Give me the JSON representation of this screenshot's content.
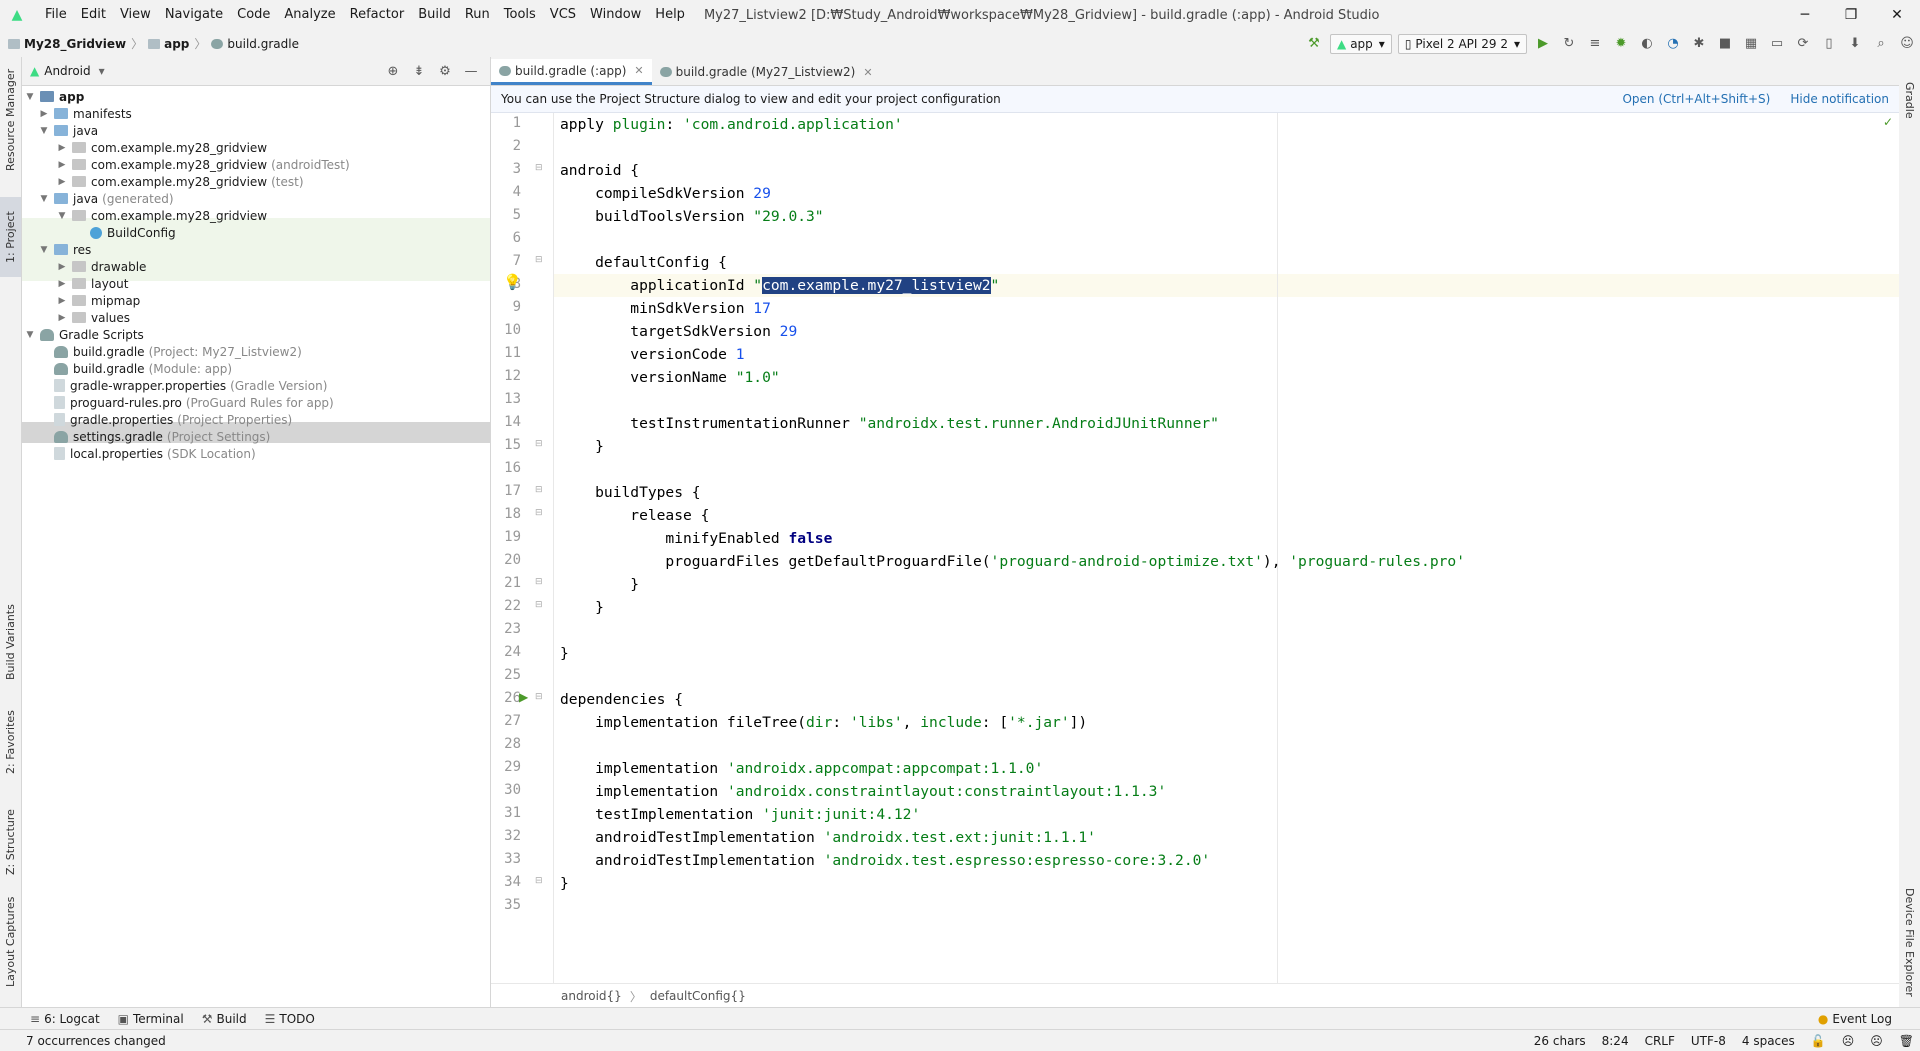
{
  "app": {
    "window_title": "My27_Listview2 [D:₩Study_Android₩workspace₩My28_Gridview] - build.gradle (:app) - Android Studio",
    "menu": [
      "File",
      "Edit",
      "View",
      "Navigate",
      "Code",
      "Analyze",
      "Refactor",
      "Build",
      "Run",
      "Tools",
      "VCS",
      "Window",
      "Help"
    ]
  },
  "navbar": {
    "crumbs": [
      "My28_Gridview",
      "app",
      "build.gradle"
    ],
    "run_config": "app",
    "device": "Pixel 2 API 29 2"
  },
  "left_stripe": [
    "Resource Manager",
    "1: Project",
    "Build Variants",
    "2: Favorites",
    "Z: Structure",
    "Layout Captures"
  ],
  "right_stripe": [
    "Gradle",
    "Device File Explorer"
  ],
  "project": {
    "view_mode": "Android",
    "tree": [
      {
        "label": "app",
        "hint": ""
      },
      {
        "label": "manifests",
        "hint": ""
      },
      {
        "label": "java",
        "hint": ""
      },
      {
        "label": "com.example.my28_gridview",
        "hint": ""
      },
      {
        "label": "com.example.my28_gridview",
        "hint": "(androidTest)"
      },
      {
        "label": "com.example.my28_gridview",
        "hint": "(test)"
      },
      {
        "label": "java",
        "hint": "(generated)"
      },
      {
        "label": "com.example.my28_gridview",
        "hint": ""
      },
      {
        "label": "BuildConfig",
        "hint": ""
      },
      {
        "label": "res",
        "hint": ""
      },
      {
        "label": "drawable",
        "hint": ""
      },
      {
        "label": "layout",
        "hint": ""
      },
      {
        "label": "mipmap",
        "hint": ""
      },
      {
        "label": "values",
        "hint": ""
      },
      {
        "label": "Gradle Scripts",
        "hint": ""
      },
      {
        "label": "build.gradle",
        "hint": "(Project: My27_Listview2)"
      },
      {
        "label": "build.gradle",
        "hint": "(Module: app)"
      },
      {
        "label": "gradle-wrapper.properties",
        "hint": "(Gradle Version)"
      },
      {
        "label": "proguard-rules.pro",
        "hint": "(ProGuard Rules for app)"
      },
      {
        "label": "gradle.properties",
        "hint": "(Project Properties)"
      },
      {
        "label": "settings.gradle",
        "hint": "(Project Settings)"
      },
      {
        "label": "local.properties",
        "hint": "(SDK Location)"
      }
    ]
  },
  "editor": {
    "tabs": [
      "build.gradle (:app)",
      "build.gradle (My27_Listview2)"
    ],
    "notification": "You can use the Project Structure dialog to view and edit your project configuration",
    "notif_open": "Open (Ctrl+Alt+Shift+S)",
    "notif_hide": "Hide notification",
    "code": {
      "l1a": "apply ",
      "l1b": "plugin",
      "l1c": ": ",
      "l1d": "'com.android.application'",
      "l3": "android {",
      "l4a": "    compileSdkVersion ",
      "l4b": "29",
      "l5a": "    buildToolsVersion ",
      "l5b": "\"29.0.3\"",
      "l7": "    defaultConfig {",
      "l8a": "        applicationId ",
      "l8b": "\"",
      "l8c": "com.example.my27_listview2",
      "l8d": "\"",
      "l9a": "        minSdkVersion ",
      "l9b": "17",
      "l10a": "        targetSdkVersion ",
      "l10b": "29",
      "l11a": "        versionCode ",
      "l11b": "1",
      "l12a": "        versionName ",
      "l12b": "\"1.0\"",
      "l14a": "        testInstrumentationRunner ",
      "l14b": "\"androidx.test.runner.AndroidJUnitRunner\"",
      "l15": "    }",
      "l17": "    buildTypes {",
      "l18": "        release {",
      "l19a": "            minifyEnabled ",
      "l19b": "false",
      "l20a": "            proguardFiles getDefaultProguardFile(",
      "l20b": "'proguard-android-optimize.txt'",
      "l20c": "), ",
      "l20d": "'proguard-rules.pro'",
      "l21": "        }",
      "l22": "    }",
      "l24": "}",
      "l26": "dependencies {",
      "l27a": "    implementation fileTree(",
      "l27b": "dir",
      "l27c": ": ",
      "l27d": "'libs'",
      "l27e": ", ",
      "l27f": "include",
      "l27g": ": [",
      "l27h": "'*.jar'",
      "l27i": "])",
      "l29a": "    implementation ",
      "l29b": "'androidx.appcompat:appcompat:1.1.0'",
      "l30a": "    implementation ",
      "l30b": "'androidx.constraintlayout:constraintlayout:1.1.3'",
      "l31a": "    testImplementation ",
      "l31b": "'junit:junit:4.12'",
      "l32a": "    androidTestImplementation ",
      "l32b": "'androidx.test.ext:junit:1.1.1'",
      "l33a": "    androidTestImplementation ",
      "l33b": "'androidx.test.espresso:espresso-core:3.2.0'",
      "l34": "}"
    },
    "line_numbers": [
      "1",
      "2",
      "3",
      "4",
      "5",
      "6",
      "7",
      "8",
      "9",
      "10",
      "11",
      "12",
      "13",
      "14",
      "15",
      "16",
      "17",
      "18",
      "19",
      "20",
      "21",
      "22",
      "23",
      "24",
      "25",
      "26",
      "27",
      "28",
      "29",
      "30",
      "31",
      "32",
      "33",
      "34",
      "35"
    ],
    "breadcrumb": [
      "android{}",
      "defaultConfig{}"
    ]
  },
  "bottom_tabs": [
    "6: Logcat",
    "Terminal",
    "Build",
    "TODO"
  ],
  "event_log": "Event Log",
  "status": {
    "message": "7 occurrences changed",
    "chars": "26 chars",
    "position": "8:24",
    "line_sep": "CRLF",
    "encoding": "UTF-8",
    "indent": "4 spaces"
  }
}
